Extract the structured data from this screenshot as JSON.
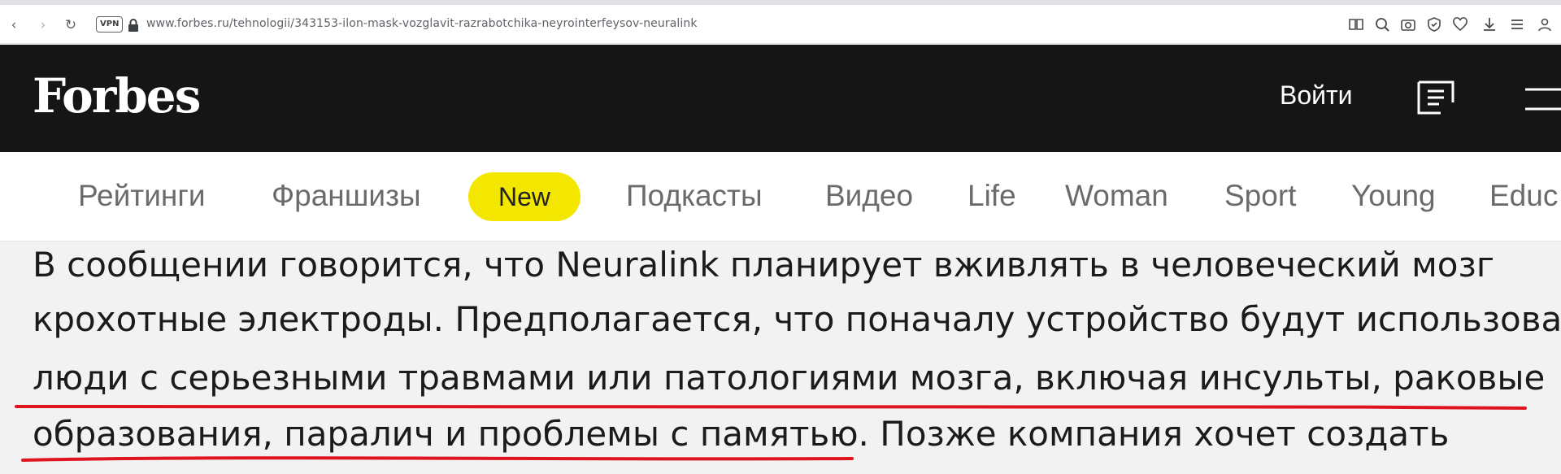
{
  "browser": {
    "url": "www.forbes.ru/tehnologii/343153-ilon-mask-vozglavit-razrabotchika-neyrointerfeysov-neuralink",
    "vpn_label": "VPN",
    "icons": [
      "back-icon",
      "forward-icon",
      "reload-icon",
      "lock-icon",
      "reader-icon",
      "search-page-icon",
      "camera-icon",
      "shield-icon",
      "heart-icon",
      "download-icon",
      "menu-icon",
      "account-icon"
    ]
  },
  "header": {
    "logo": "Forbes",
    "login": "Войти"
  },
  "nav": {
    "items": [
      "Рейтинги",
      "Франшизы",
      "New",
      "Подкасты",
      "Видео",
      "Life",
      "Woman",
      "Sport",
      "Young",
      "Educ"
    ]
  },
  "article": {
    "lines": [
      "В сообщении говорится, что Neuralink планирует вживлять в человеческий мозг",
      "крохотные электроды. Предполагается, что поначалу устройство будут использовать",
      "люди с серьезными травмами или патологиями мозга, включая инсульты, раковые",
      "образования, паралич и проблемы с памятью. Позже компания хочет создать"
    ]
  },
  "colors": {
    "header_bg": "#151515",
    "new_pill": "#f3e600",
    "underline": "#e0141e",
    "nav_text": "#6b6b6b"
  }
}
